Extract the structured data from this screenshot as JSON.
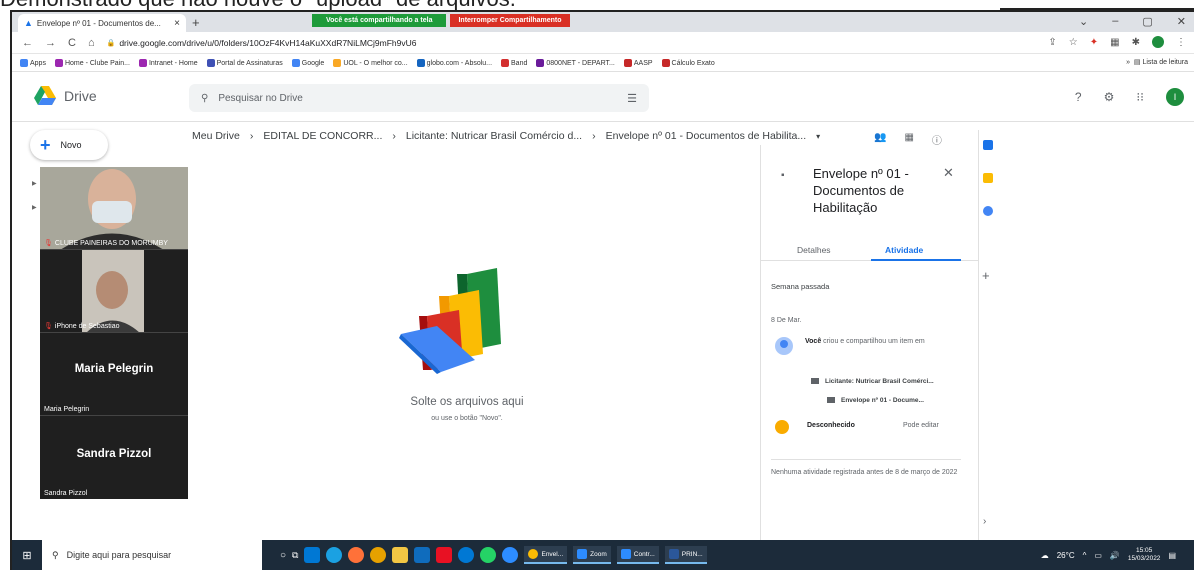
{
  "caption": "Demonstrado que não houve o \"upload\" de arquivos.",
  "browser": {
    "tab_title": "Envelope nº 01 - Documentos de...",
    "share_text": "Você está compartilhando a tela",
    "stop_share": "Interromper Compartilhamento",
    "url": "drive.google.com/drive/u/0/folders/10OzF4KvH14aKuXXdR7NiLMCj9mFh9vU6",
    "bookmarks": [
      {
        "label": "Apps",
        "color": "#4285f4"
      },
      {
        "label": "Home - Clube Pain...",
        "color": "#9c27b0"
      },
      {
        "label": "Intranet - Home",
        "color": "#9c27b0"
      },
      {
        "label": "Portal de Assinaturas",
        "color": "#3f51b5"
      },
      {
        "label": "Google",
        "color": "#4285f4"
      },
      {
        "label": "UOL - O melhor co...",
        "color": "#f9a825"
      },
      {
        "label": "globo.com - Absolu...",
        "color": "#1565c0"
      },
      {
        "label": "Band",
        "color": "#d32f2f"
      },
      {
        "label": "0800NET - DEPART...",
        "color": "#6a1b9a"
      },
      {
        "label": "AASP",
        "color": "#c62828"
      },
      {
        "label": "Cálculo Exato",
        "color": "#c62828"
      }
    ],
    "reading_list": "Lista de leitura"
  },
  "drive": {
    "logo_text": "Drive",
    "search_placeholder": "Pesquisar no Drive",
    "avatar_letter": "I",
    "new_label": "Novo",
    "breadcrumb": [
      "Meu Drive",
      "EDITAL DE CONCORR...",
      "Licitante: Nutricar Brasil Comércio d...",
      "Envelope nº 01 - Documentos de Habilita..."
    ],
    "drop_title": "Solte os arquivos aqui",
    "drop_sub": "ou use o botão \"Novo\"."
  },
  "zoom": {
    "tiles": [
      {
        "label": "CLUBE PAINEIRAS DO MORUMBY"
      },
      {
        "label": "iPhone de Sebastiao"
      },
      {
        "name": "Maria Pelegrin",
        "label": "Maria Pelegrin"
      },
      {
        "name": "Sandra Pizzol",
        "label": "Sandra Pizzol"
      }
    ]
  },
  "panel": {
    "title": "Envelope nº 01 - Documentos de Habilitação",
    "tab_details": "Detalhes",
    "tab_activity": "Atividade",
    "section": "Semana passada",
    "date": "8 De Mar.",
    "actor": "Você",
    "action": "criou e compartilhou um item em",
    "folder1": "Licitante: Nutricar Brasil Comérci...",
    "folder2": "Envelope nº 01 - Docume...",
    "user": "Desconhecido",
    "permission": "Pode editar",
    "no_history": "Nenhuma atividade registrada antes de 8 de março de 2022"
  },
  "taskbar": {
    "search_placeholder": "Digite aqui para pesquisar",
    "apps": [
      "Envel...",
      "Zoom",
      "Contr...",
      "PRIN..."
    ],
    "weather": "26°C",
    "time": "15:05",
    "date": "15/03/2022"
  }
}
